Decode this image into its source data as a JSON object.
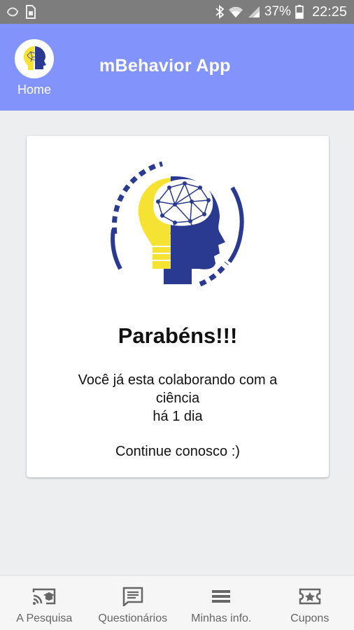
{
  "status_bar": {
    "battery_percent": "37%",
    "time": "22:25",
    "left_icons": [
      "sync-icon",
      "sim-card-icon"
    ],
    "right_icons": [
      "bluetooth-icon",
      "wifi-icon",
      "signal-icon",
      "battery-icon"
    ]
  },
  "app_bar": {
    "home_label": "Home",
    "title": "mBehavior App",
    "background_color": "#8294fb"
  },
  "card": {
    "logo_icon": "brain-lightbulb-logo",
    "title": "Parabéns!!!",
    "message_line1": "Você já esta colaborando com a",
    "message_line2": "ciência",
    "message_line3": "há 1 dia",
    "cta": "Continue conosco :)"
  },
  "bottom_nav": {
    "items": [
      {
        "label": "A Pesquisa",
        "icon": "cast-school-icon"
      },
      {
        "label": "Questionários",
        "icon": "chat-list-icon"
      },
      {
        "label": "Minhas info.",
        "icon": "menu-lines-icon"
      },
      {
        "label": "Cupons",
        "icon": "ticket-star-icon"
      }
    ]
  },
  "colors": {
    "brand_blue": "#2b3a91",
    "brand_yellow": "#f5e233",
    "app_bar": "#8294fb"
  }
}
